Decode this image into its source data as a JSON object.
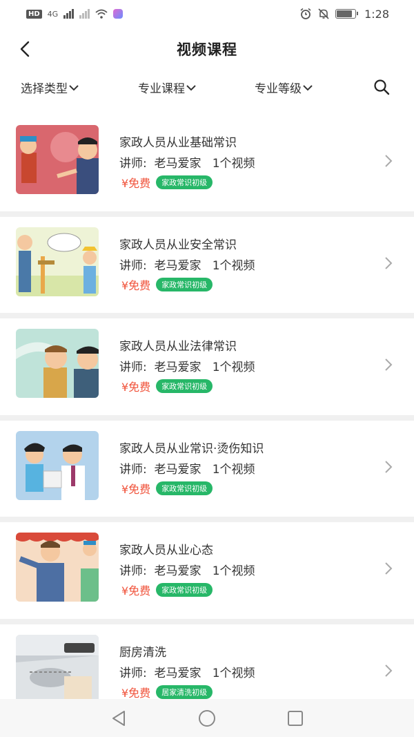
{
  "status_bar": {
    "hd": "HD",
    "network": "4G",
    "time": "1:28",
    "battery_level": 0.85,
    "icons": [
      "hd-icon",
      "signal-icon",
      "signal-icon",
      "wifi-icon",
      "app-notification-icon",
      "alarm-icon",
      "mute-icon",
      "battery-icon"
    ]
  },
  "header": {
    "title": "视频课程",
    "back_icon": "chevron-left-icon"
  },
  "filters": {
    "type": "选择类型",
    "course": "专业课程",
    "level": "专业等级",
    "search_icon": "search-icon"
  },
  "colors": {
    "price": "#f0523a",
    "tag": "#27b768",
    "divider": "#f0f0f0"
  },
  "courses": [
    {
      "title": "家政人员从业基础常识",
      "meta": "讲师:  老马爱家   1个视频",
      "price": "¥免费",
      "tag": "家政常识初级"
    },
    {
      "title": "家政人员从业安全常识",
      "meta": "讲师:  老马爱家   1个视频",
      "price": "¥免费",
      "tag": "家政常识初级"
    },
    {
      "title": "家政人员从业法律常识",
      "meta": "讲师:  老马爱家   1个视频",
      "price": "¥免费",
      "tag": "家政常识初级"
    },
    {
      "title": "家政人员从业常识·烫伤知识",
      "meta": "讲师:  老马爱家   1个视频",
      "price": "¥免费",
      "tag": "家政常识初级"
    },
    {
      "title": "家政人员从业心态",
      "meta": "讲师:  老马爱家   1个视频",
      "price": "¥免费",
      "tag": "家政常识初级"
    },
    {
      "title": "厨房清洗",
      "meta": "讲师:  老马爱家   1个视频",
      "price": "¥免费",
      "tag": "居家清洗初级"
    }
  ],
  "nav": {
    "back": "triangle-back-icon",
    "home": "circle-home-icon",
    "recents": "square-recents-icon"
  }
}
